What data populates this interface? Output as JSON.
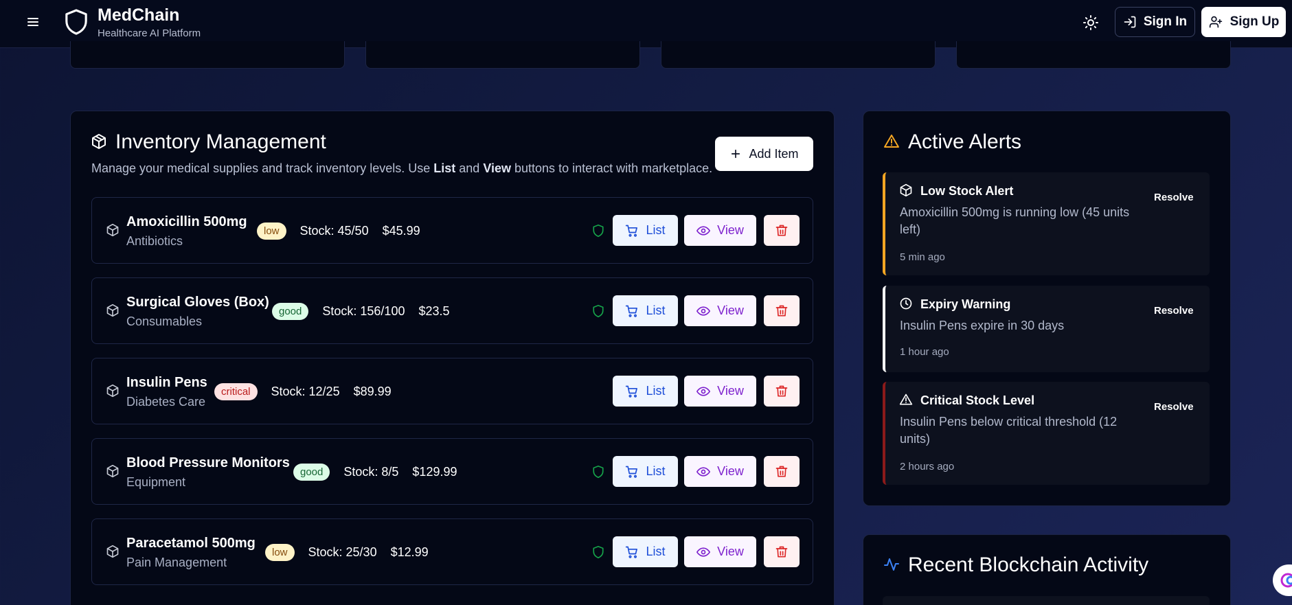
{
  "header": {
    "brand_title": "MedChain",
    "brand_subtitle": "Healthcare AI Platform",
    "sign_in_label": "Sign In",
    "sign_up_label": "Sign Up"
  },
  "inventory": {
    "title": "Inventory Management",
    "description_parts": [
      "Manage your medical supplies and track inventory levels. Use ",
      "List",
      " and ",
      "View",
      " buttons to interact with marketplace."
    ],
    "add_item_label": "Add Item",
    "list_label": "List",
    "view_label": "View",
    "items": [
      {
        "name": "Amoxicillin 500mg",
        "category": "Antibiotics",
        "status": "low",
        "stock": "Stock: 45/50",
        "price": "$45.99",
        "verified": true
      },
      {
        "name": "Surgical Gloves (Box)",
        "category": "Consumables",
        "status": "good",
        "stock": "Stock: 156/100",
        "price": "$23.5",
        "verified": true
      },
      {
        "name": "Insulin Pens",
        "category": "Diabetes Care",
        "status": "critical",
        "stock": "Stock: 12/25",
        "price": "$89.99",
        "verified": false
      },
      {
        "name": "Blood Pressure Monitors",
        "category": "Equipment",
        "status": "good",
        "stock": "Stock: 8/5",
        "price": "$129.99",
        "verified": true
      },
      {
        "name": "Paracetamol 500mg",
        "category": "Pain Management",
        "status": "low",
        "stock": "Stock: 25/30",
        "price": "$12.99",
        "verified": true
      }
    ]
  },
  "alerts": {
    "title": "Active Alerts",
    "resolve_label": "Resolve",
    "items": [
      {
        "title": "Low Stock Alert",
        "message": "Amoxicillin 500mg is running low (45 units left)",
        "time": "5 min ago",
        "icon": "package-icon",
        "color": "#f5a623"
      },
      {
        "title": "Expiry Warning",
        "message": "Insulin Pens expire in 30 days",
        "time": "1 hour ago",
        "icon": "clock-icon",
        "color": "#ffffff"
      },
      {
        "title": "Critical Stock Level",
        "message": "Insulin Pens below critical threshold (12 units)",
        "time": "2 hours ago",
        "icon": "warning-icon",
        "color": "#8b1a1a"
      }
    ]
  },
  "activity": {
    "title": "Recent Blockchain Activity"
  },
  "colors": {
    "accent_blue": "#1d4ed8",
    "accent_purple": "#7e22ce",
    "danger": "#dc2626",
    "verified_green": "#16a34a",
    "warning_amber": "#f5a623"
  }
}
